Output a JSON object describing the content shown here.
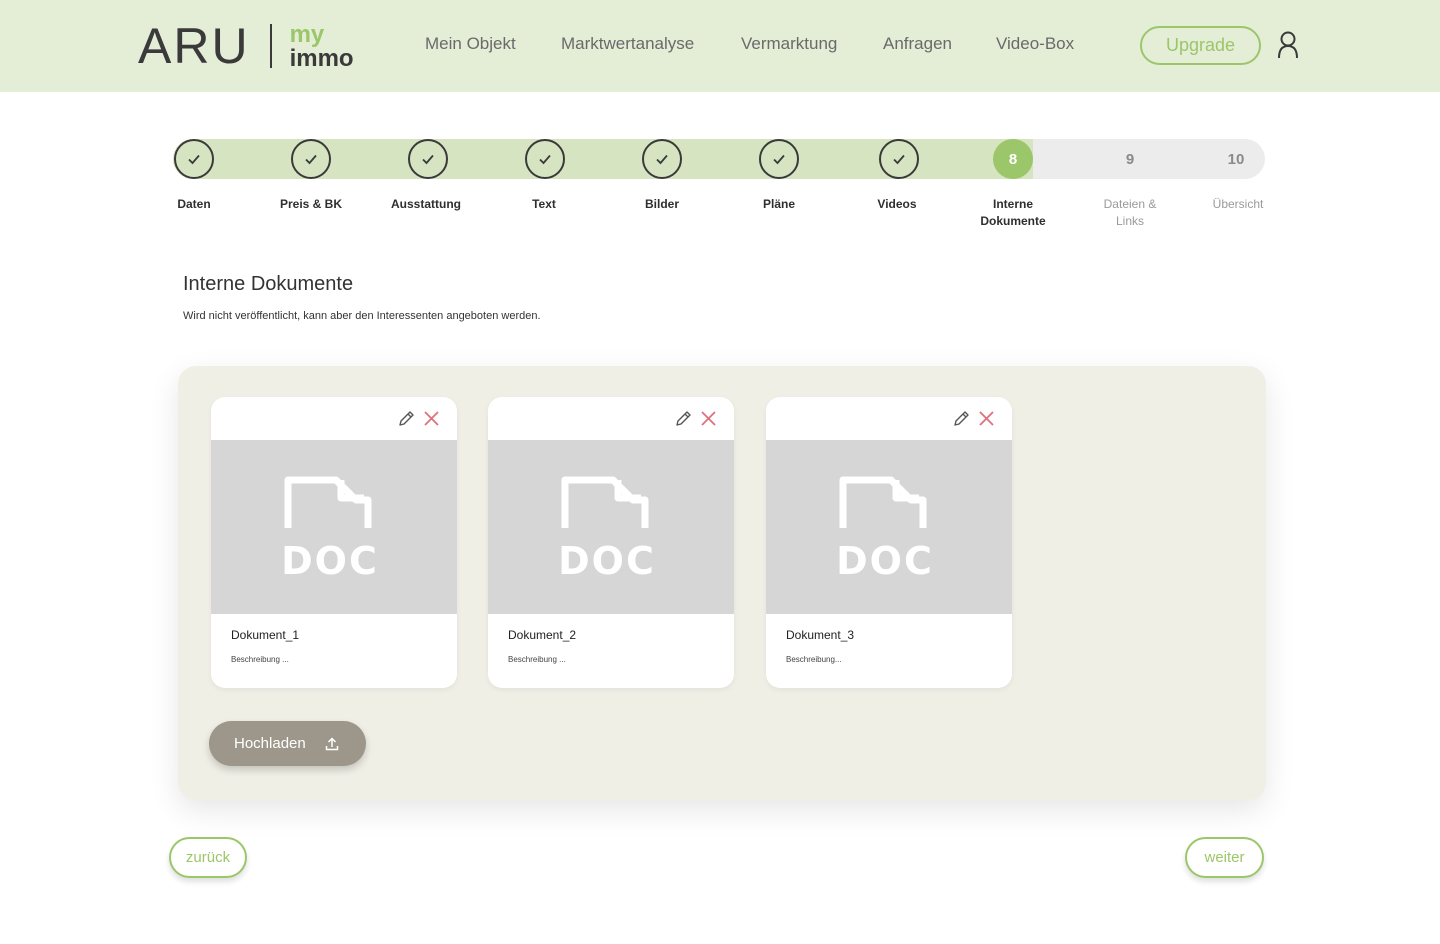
{
  "brand": {
    "logo_main": "ARU",
    "logo_my": "my",
    "logo_immo": "immo"
  },
  "nav": [
    {
      "label": "Mein Objekt"
    },
    {
      "label": "Marktwertanalyse"
    },
    {
      "label": "Vermarktung"
    },
    {
      "label": "Anfragen"
    },
    {
      "label": "Video-Box"
    }
  ],
  "header": {
    "upgrade_label": "Upgrade",
    "user_icon": "user-icon"
  },
  "steps": [
    {
      "label": "Daten",
      "state": "done"
    },
    {
      "label": "Preis & BK",
      "state": "done"
    },
    {
      "label": "Ausstattung",
      "state": "done"
    },
    {
      "label": "Text",
      "state": "done"
    },
    {
      "label": "Bilder",
      "state": "done"
    },
    {
      "label": "Pläne",
      "state": "done"
    },
    {
      "label": "Videos",
      "state": "done"
    },
    {
      "number": "8",
      "label": "Interne Dokumente",
      "state": "active"
    },
    {
      "number": "9",
      "label": "Dateien & Links",
      "state": "todo"
    },
    {
      "number": "10",
      "label": "Übersicht",
      "state": "todo"
    }
  ],
  "main": {
    "title": "Interne Dokumente",
    "subtitle": "Wird nicht veröffentlicht, kann aber den Interessenten angeboten werden."
  },
  "documents": [
    {
      "name": "Dokument_1",
      "description": "Beschreibung ...",
      "type_label": "DOC"
    },
    {
      "name": "Dokument_2",
      "description": "Beschreibung ...",
      "type_label": "DOC"
    },
    {
      "name": "Dokument_3",
      "description": "Beschreibung...",
      "type_label": "DOC"
    }
  ],
  "actions": {
    "upload_label": "Hochladen",
    "back_label": "zurück",
    "next_label": "weiter"
  },
  "colors": {
    "accent": "#9cc66a",
    "header_bg": "#e4edd6",
    "panel_bg": "#f0efe6",
    "upload_bg": "#9c978a",
    "delete": "#e0707a"
  }
}
